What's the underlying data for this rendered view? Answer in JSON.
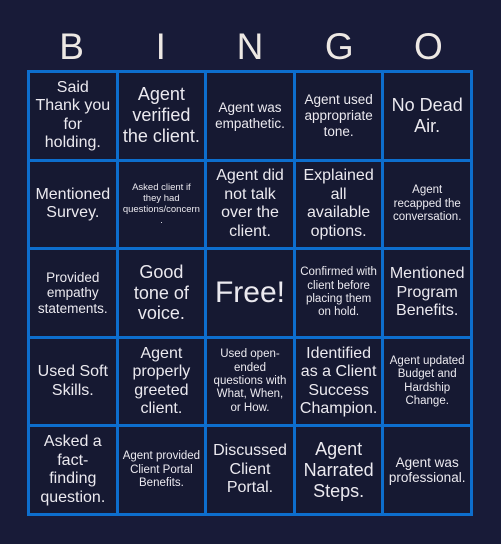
{
  "card": {
    "title": "BINGO",
    "header_letters": [
      "B",
      "I",
      "N",
      "G",
      "O"
    ],
    "colors": {
      "page_background": "#181b38",
      "cell_background": "#161932",
      "grid_line": "#0d6ecd",
      "header_text": "#ede8e4",
      "cell_text": "#ebe9ef"
    },
    "grid_size": "5x5",
    "cells": [
      {
        "id": "B1",
        "text": "Said Thank you for holding.",
        "size": "lg",
        "free": false
      },
      {
        "id": "I1",
        "text": "Agent verified the client.",
        "size": "xl",
        "free": false
      },
      {
        "id": "N1",
        "text": "Agent was empathetic.",
        "size": "md",
        "free": false
      },
      {
        "id": "G1",
        "text": "Agent used appropriate tone.",
        "size": "md",
        "free": false
      },
      {
        "id": "O1",
        "text": "No Dead Air.",
        "size": "xl",
        "free": false
      },
      {
        "id": "B2",
        "text": "Mentioned Survey.",
        "size": "lg",
        "free": false
      },
      {
        "id": "I2",
        "text": "Asked client if they had questions/concern.",
        "size": "xs",
        "free": false
      },
      {
        "id": "N2",
        "text": "Agent did not talk over the client.",
        "size": "lg",
        "free": false
      },
      {
        "id": "G2",
        "text": "Explained all available options.",
        "size": "lg",
        "free": false
      },
      {
        "id": "O2",
        "text": "Agent recapped the conversation.",
        "size": "sm",
        "free": false
      },
      {
        "id": "B3",
        "text": "Provided empathy statements.",
        "size": "md",
        "free": false
      },
      {
        "id": "I3",
        "text": "Good tone of voice.",
        "size": "xl",
        "free": false
      },
      {
        "id": "N3",
        "text": "Free!",
        "size": "free",
        "free": true
      },
      {
        "id": "G3",
        "text": "Confirmed with client before placing them on hold.",
        "size": "sm",
        "free": false
      },
      {
        "id": "O3",
        "text": "Mentioned Program Benefits.",
        "size": "lg",
        "free": false
      },
      {
        "id": "B4",
        "text": "Used Soft Skills.",
        "size": "lg",
        "free": false
      },
      {
        "id": "I4",
        "text": "Agent properly greeted client.",
        "size": "lg",
        "free": false
      },
      {
        "id": "N4",
        "text": "Used open-ended questions with What, When, or How.",
        "size": "sm",
        "free": false
      },
      {
        "id": "G4",
        "text": "Identified as a Client Success Champion.",
        "size": "lg",
        "free": false
      },
      {
        "id": "O4",
        "text": "Agent updated Budget and Hardship Change.",
        "size": "sm",
        "free": false
      },
      {
        "id": "B5",
        "text": "Asked a fact-finding question.",
        "size": "lg",
        "free": false
      },
      {
        "id": "I5",
        "text": "Agent provided Client Portal Benefits.",
        "size": "sm",
        "free": false
      },
      {
        "id": "N5",
        "text": "Discussed Client Portal.",
        "size": "lg",
        "free": false
      },
      {
        "id": "G5",
        "text": "Agent Narrated Steps.",
        "size": "xl",
        "free": false
      },
      {
        "id": "O5",
        "text": "Agent was professional.",
        "size": "md",
        "free": false
      }
    ]
  }
}
